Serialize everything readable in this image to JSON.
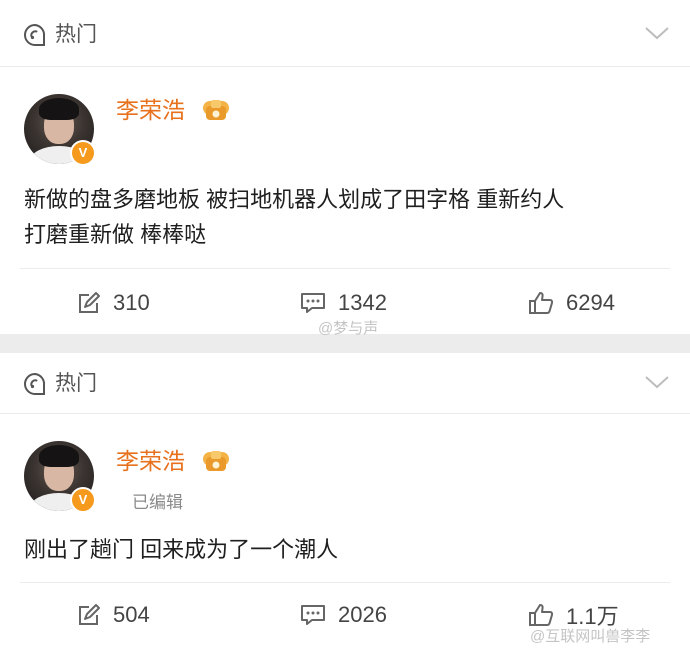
{
  "posts": [
    {
      "tag": "热门",
      "username": "李荣浩",
      "verified": "V",
      "edited": "",
      "text_lines": [
        "新做的盘多磨地板 被扫地机器人划成了田字格 重新约人",
        "打磨重新做 棒棒哒"
      ],
      "reposts": "310",
      "comments": "1342",
      "likes": "6294"
    },
    {
      "tag": "热门",
      "username": "李荣浩",
      "verified": "V",
      "edited": "已编辑",
      "text_lines": [
        "刚出了趟门 回来成为了一个潮人"
      ],
      "reposts": "504",
      "comments": "2026",
      "likes": "1.1万"
    }
  ],
  "watermarks": [
    "@梦与声",
    "@互联网叫兽李李"
  ],
  "colors": {
    "username": "#e8711d",
    "badge": "#f59a1c",
    "background": "#ececec"
  }
}
